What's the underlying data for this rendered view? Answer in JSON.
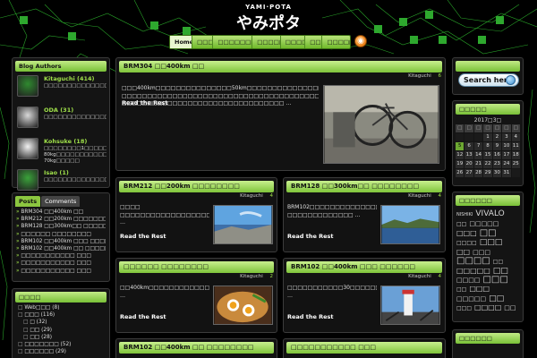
{
  "site": {
    "logo_small": "YAMI·POTA",
    "logo_big": "やみポタ"
  },
  "nav": {
    "items": [
      "Home",
      "□□□",
      "□□□□□□□□",
      "□□□□□",
      "□□□□",
      "□□",
      "□□□□□"
    ]
  },
  "sidebar_left": {
    "authors_title": "Blog Authors",
    "authors": [
      {
        "name": "Kitaguchi (414)",
        "desc": "□□□□□□□□□□□□□□□□□□□□□□□□□□□□□□□□□□□",
        "color": "#2f8a2f"
      },
      {
        "name": "ODA (31)",
        "desc": "□□□□□□□□□□□□□□□□□□□□□□□□□□□□□□□",
        "color": "#d9d9d9"
      },
      {
        "name": "Kohsuke (18)",
        "desc": "□□□□□□□□1□□□□□□10kg□□ 80kg□□□□□□□□□□□□□□□ 70kg□□□□□",
        "color": "#f2f2f2"
      },
      {
        "name": "Isao (1)",
        "desc": "□□□□□□□□□□□□□□□□□□□□□□□□□□□□□□",
        "color": "#3aa33a"
      }
    ],
    "recent": {
      "tabs": [
        "Posts",
        "Comments"
      ],
      "items": [
        "BRM304 □□400km □□",
        "BRM212 □□200km □□□□□□□□",
        "BRM128 □□300km□□ □□□□□□□□",
        "□□□□□□ □□□□□□□□",
        "BRM102 □□400km □□□ □□□□□□",
        "BRM102 □□400km □□ □□□□□□□□",
        "□□□□□□□□□□□ □□□",
        "□□□□□□□□□□□ □□□",
        "□□□□□□□□□□□ □□□"
      ]
    },
    "categories": {
      "title": "□□□□",
      "items": [
        {
          "label": "Web□□□ (8)",
          "sub": false
        },
        {
          "label": "□□□ (116)",
          "sub": false
        },
        {
          "label": "□ (32)",
          "sub": true
        },
        {
          "label": "□□ (29)",
          "sub": true
        },
        {
          "label": "□□ (28)",
          "sub": true
        },
        {
          "label": "□□□□□□□ (52)",
          "sub": false
        },
        {
          "label": "□□□□□□ (29)",
          "sub": false
        }
      ]
    }
  },
  "posts": {
    "main": {
      "title": "BRM304 □□400km □□",
      "author": "Kitaguchi",
      "comments": "6",
      "excerpt": "□□□400km□□□□□□□□□□□□□□□50km□□□□□□□□□□□□□□□□□□□□□□□□ □□□□□□□□□□□□□□□□□□□□□□□□□□□□□□□□□□□□□□□□□□□□□□□□□□□□□□□□□ □□□□□□□□□□□□□□□□□□□□□□□□□□□□□□□□ …",
      "read_more": "Read the Rest"
    },
    "a": {
      "title": "BRM212 □□200km □□□□□□□□",
      "author": "Kitaguchi",
      "comments": "4",
      "excerpt": "□□□□ □□□□□□□□□□□□□□□□□□□□□□□□□□□□□□□□□□□□□□□□□□□□□□□□□□□□□□□□□□□□□ …",
      "read_more": "Read the Rest"
    },
    "b": {
      "title": "BRM128 □□300km□□ □□□□□□□□",
      "author": "Kitaguchi",
      "comments": "4",
      "excerpt": "BRM102□□□□□□□□□□□□□□□□□□□□□□□□□□□□□□□□□□□□□□□□300km□□□□□□□□ □□□□□□□□□□□□□ …",
      "read_more": "Read the Rest"
    },
    "c": {
      "title": "□□□□□□ □□□□□□□□",
      "author": "Kitaguchi",
      "comments": "2",
      "excerpt": "□□400km□□□□□□□□□□□□□□□□□□□□□□□□□□□□□□□□□□□□□□□□□□□□□□□□□□□□□□ …",
      "read_more": "Read the Rest"
    },
    "d": {
      "title": "BRM102 □□400km □□□ □□□□□□",
      "author": "Kitaguchi",
      "comments": "4",
      "excerpt": "□□□□□□□□□□□30□□□□□□□□□□□□□□□□□□□□□□□□□□□□□□□□□□□□□□□□□□□□□□ …",
      "read_more": "Read the Rest"
    },
    "e": {
      "title": "BRM102 □□400km □□ □□□□□□□□"
    },
    "f": {
      "title": "□□□□□□□□□□□ □□□"
    }
  },
  "sidebar_right": {
    "search_label": "Search here",
    "calendar": {
      "title": "□□□□□",
      "month": "2017□3□",
      "head": [
        "□",
        "□",
        "□",
        "□",
        "□",
        "□",
        "□"
      ],
      "days": [
        "",
        "",
        "",
        "1",
        "2",
        "3",
        "4",
        "5",
        "6",
        "7",
        "8",
        "9",
        "10",
        "11",
        "12",
        "13",
        "14",
        "15",
        "16",
        "17",
        "18",
        "19",
        "20",
        "21",
        "22",
        "23",
        "24",
        "25",
        "26",
        "27",
        "28",
        "29",
        "30",
        "31",
        ""
      ],
      "today": "5"
    },
    "tags": {
      "title": "□□□□□□",
      "items": [
        {
          "t": "NISHIKI",
          "s": 5
        },
        {
          "t": "VIVALO",
          "s": 9
        },
        {
          "t": "□□",
          "s": 6
        },
        {
          "t": "□□□□□",
          "s": 7
        },
        {
          "t": "□□□",
          "s": 8
        },
        {
          "t": "□□",
          "s": 10
        },
        {
          "t": "□□□□",
          "s": 6
        },
        {
          "t": "□□□",
          "s": 9
        },
        {
          "t": "□□",
          "s": 8
        },
        {
          "t": "□□□",
          "s": 7
        },
        {
          "t": "□□□□",
          "s": 10
        },
        {
          "t": "□□",
          "s": 6
        },
        {
          "t": "□□□□□",
          "s": 8
        },
        {
          "t": "□□",
          "s": 9
        },
        {
          "t": "□□□□",
          "s": 7
        },
        {
          "t": "□□□",
          "s": 10
        },
        {
          "t": "□□",
          "s": 6
        },
        {
          "t": "□□□",
          "s": 8
        },
        {
          "t": "□□□□□",
          "s": 7
        },
        {
          "t": "□□",
          "s": 9
        },
        {
          "t": "□□□",
          "s": 6
        },
        {
          "t": "□□□□",
          "s": 8
        },
        {
          "t": "□□",
          "s": 7
        }
      ]
    },
    "archive_title": "□□□□□□"
  },
  "colors": {
    "accent_green": "#8cc640",
    "map_line": "#3cff3c",
    "background": "#000000"
  }
}
